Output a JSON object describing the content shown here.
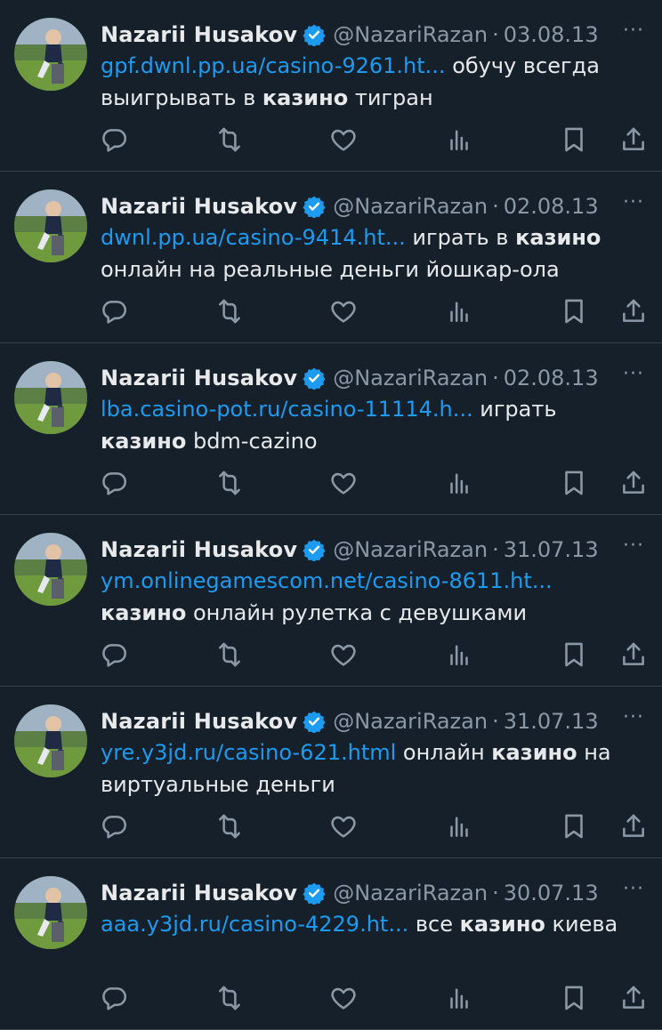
{
  "colors": {
    "background": "#15202b",
    "link": "#1d9bf0",
    "muted": "#8b98a5",
    "verified": "#1d9bf0"
  },
  "tweets": [
    {
      "name": "Nazarii Husakov",
      "handle": "@NazariRazan",
      "sep": "·",
      "date": "03.08.13",
      "more": "···",
      "link": "gpf.dwnl.pp.ua/casino-9261.ht...",
      "text1": " обучу всегда выигрывать в ",
      "keyword": "казино",
      "text2": " тигран"
    },
    {
      "name": "Nazarii Husakov",
      "handle": "@NazariRazan",
      "sep": "·",
      "date": "02.08.13",
      "more": "···",
      "link": "dwnl.pp.ua/casino-9414.ht...",
      "text1": " играть в ",
      "keyword": "казино",
      "text2": " онлайн на реальные деньги йошкар-ола"
    },
    {
      "name": "Nazarii Husakov",
      "handle": "@NazariRazan",
      "sep": "·",
      "date": "02.08.13",
      "more": "···",
      "link": "lba.casino-pot.ru/casino-11114.h...",
      "text1": " играть ",
      "keyword": "казино",
      "text2": " bdm-cazino"
    },
    {
      "name": "Nazarii Husakov",
      "handle": "@NazariRazan",
      "sep": "·",
      "date": "31.07.13",
      "more": "···",
      "link": "ym.onlinegamescom.net/casino-8611.ht...",
      "text1": " ",
      "keyword": "казино",
      "text2": " онлайн рулетка с девушками"
    },
    {
      "name": "Nazarii Husakov",
      "handle": "@NazariRazan",
      "sep": "·",
      "date": "31.07.13",
      "more": "···",
      "link": "yre.y3jd.ru/casino-621.html",
      "text1": " онлайн ",
      "keyword": "казино",
      "text2": " на виртуальные деньги"
    },
    {
      "name": "Nazarii Husakov",
      "handle": "@NazariRazan",
      "sep": "·",
      "date": "30.07.13",
      "more": "···",
      "link": "aaa.y3jd.ru/casino-4229.ht...",
      "text1": " все ",
      "keyword": "казино",
      "text2": " киева"
    }
  ],
  "action_icons": [
    "reply-icon",
    "retweet-icon",
    "like-icon",
    "views-icon",
    "bookmark-icon",
    "share-icon"
  ]
}
